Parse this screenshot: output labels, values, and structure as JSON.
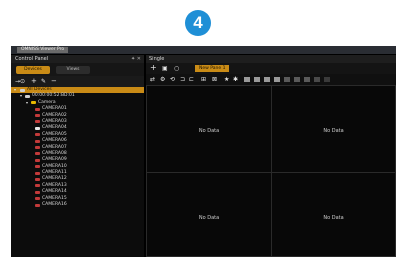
{
  "step_badge": "4",
  "window": {
    "title": "OMNISS Viewer Pro"
  },
  "control_panel": {
    "title": "Control Panel",
    "controls": "✦ ✕",
    "tabs": [
      {
        "label": "Devices"
      },
      {
        "label": "Views"
      }
    ],
    "toolbar": [
      "→⊙",
      "+",
      "✎",
      "−"
    ],
    "tree": {
      "root": "All Devices",
      "server": "00:00:00:52:BD:01",
      "group": "Camera",
      "cameras": [
        "CAMERA01",
        "CAMERA02",
        "CAMERA03",
        "CAMERA04",
        "CAMERA05",
        "CAMERA06",
        "CAMERA07",
        "CAMERA08",
        "CAMERA09",
        "CAMERA10",
        "CAMERA11",
        "CAMERA12",
        "CAMERA13",
        "CAMERA14",
        "CAMERA15",
        "CAMERA16"
      ]
    }
  },
  "single_panel": {
    "title": "Single",
    "toolbar_buttons": [
      "+",
      "▣",
      "○"
    ],
    "new_pane_label": "New Pane 1",
    "view_toolbar": [
      "⇄",
      "⚙",
      "⟲",
      "⊐",
      "⊏",
      "⊞",
      "⊠",
      "★",
      "✱"
    ],
    "cells": [
      {
        "text": "No Data"
      },
      {
        "text": "No Data"
      },
      {
        "text": "No Data"
      },
      {
        "text": "No Data"
      }
    ]
  }
}
